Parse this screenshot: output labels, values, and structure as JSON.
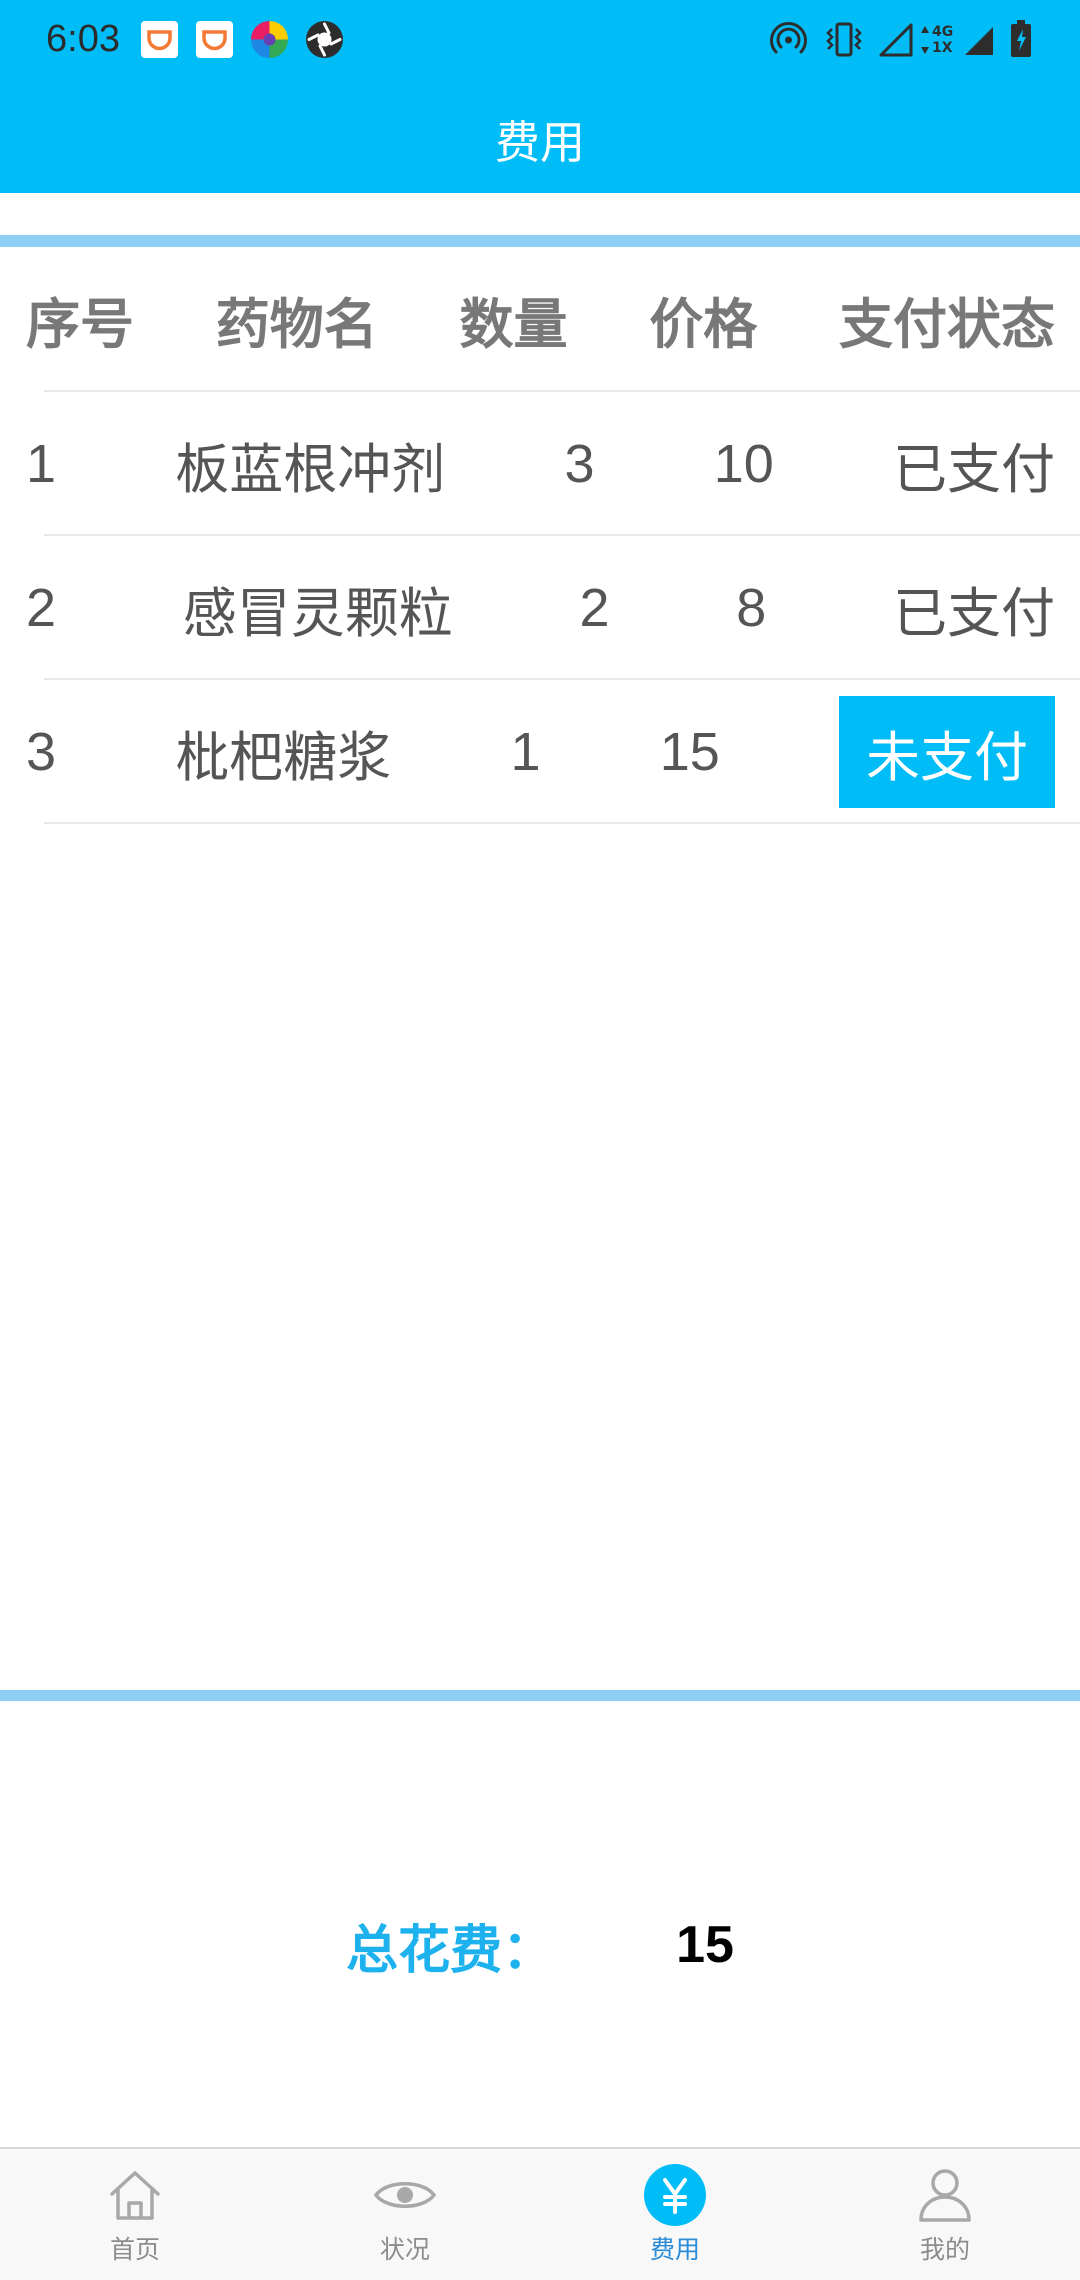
{
  "status_bar": {
    "time": "6:03",
    "notification_icons": [
      "didi-icon",
      "didi-icon",
      "multicolor-app-icon",
      "aperture-app-icon"
    ],
    "system_icons": [
      "hotspot-icon",
      "vibrate-icon",
      "signal-outline-icon",
      "network-type-icon",
      "signal-icon",
      "battery-charging-icon"
    ],
    "network_labels": [
      "4G",
      "1X"
    ]
  },
  "header": {
    "title": "费用"
  },
  "fee_table": {
    "columns": [
      "序号",
      "药物名",
      "数量",
      "价格",
      "支付状态"
    ],
    "rows": [
      {
        "no": "1",
        "drug": "板蓝根冲剂",
        "quantity": "3",
        "price": "10",
        "status": "已支付",
        "paid": true
      },
      {
        "no": "2",
        "drug": "感冒灵颗粒",
        "quantity": "2",
        "price": "8",
        "status": "已支付",
        "paid": true
      },
      {
        "no": "3",
        "drug": "枇杷糖浆",
        "quantity": "1",
        "price": "15",
        "status": "未支付",
        "paid": false
      }
    ]
  },
  "total": {
    "label": "总花费：",
    "value": "15"
  },
  "bottom_nav": {
    "items": [
      {
        "label": "首页",
        "icon": "home-icon",
        "active": false
      },
      {
        "label": "状况",
        "icon": "eye-icon",
        "active": false
      },
      {
        "label": "费用",
        "icon": "yen-icon",
        "active": true
      },
      {
        "label": "我的",
        "icon": "person-icon",
        "active": false
      }
    ]
  },
  "colors": {
    "primary": "#00bdf8",
    "accent_line": "#8dcff2",
    "header_text": "#787878",
    "cell_text": "#555555",
    "total_label": "#1db1ee",
    "nav_active": "#2a8bd8",
    "nav_inactive": "#8c8c8c",
    "nav_icon": "#a8a8a8"
  }
}
